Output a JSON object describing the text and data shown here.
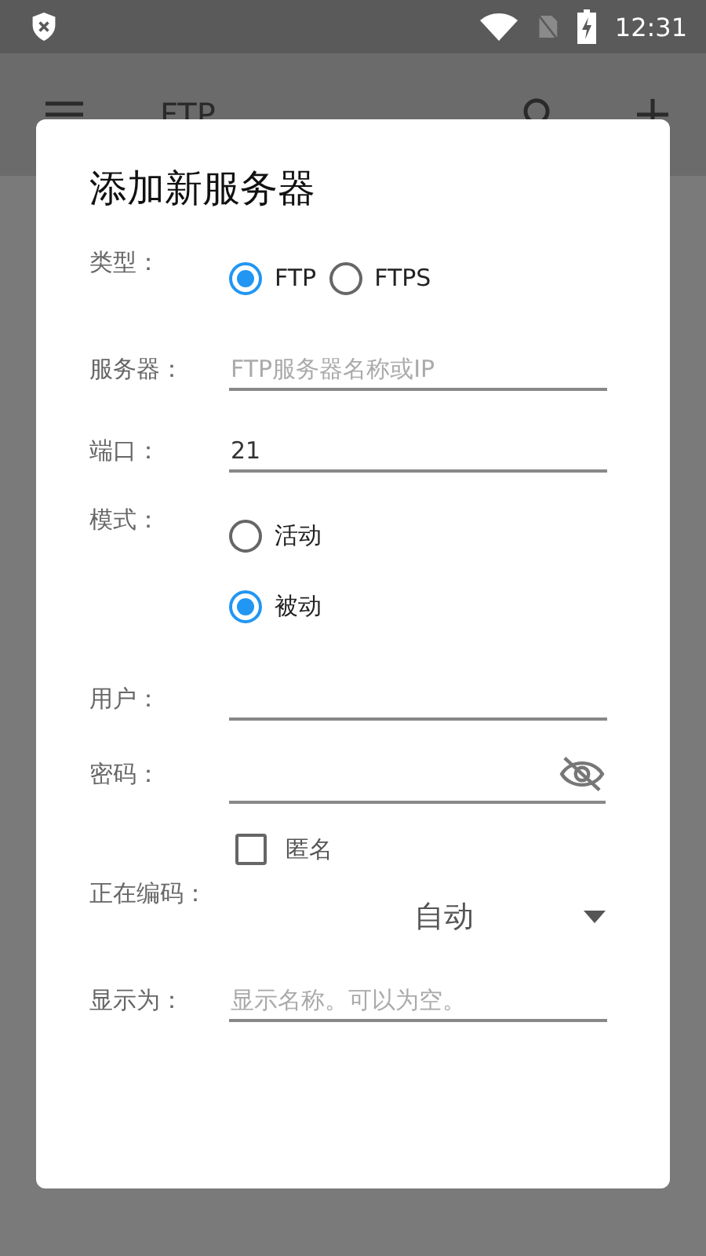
{
  "status_bar": {
    "time": "12:31"
  },
  "app_bar": {
    "title": "FTP"
  },
  "dialog": {
    "title": "添加新服务器",
    "type": {
      "label": "类型：",
      "options": [
        {
          "label": "FTP",
          "selected": true
        },
        {
          "label": "FTPS",
          "selected": false
        }
      ]
    },
    "server": {
      "label": "服务器：",
      "placeholder": "FTP服务器名称或IP"
    },
    "port": {
      "label": "端口：",
      "value": "21"
    },
    "mode": {
      "label": "模式：",
      "options": [
        {
          "label": "活动",
          "selected": false
        },
        {
          "label": "被动",
          "selected": true
        }
      ]
    },
    "user": {
      "label": "用户："
    },
    "password": {
      "label": "密码："
    },
    "anonymous": {
      "label": "匿名",
      "checked": false
    },
    "encoding": {
      "label": "正在编码：",
      "value": "自动"
    },
    "display_as": {
      "label": "显示为：",
      "placeholder": "显示名称。可以为空。"
    }
  }
}
